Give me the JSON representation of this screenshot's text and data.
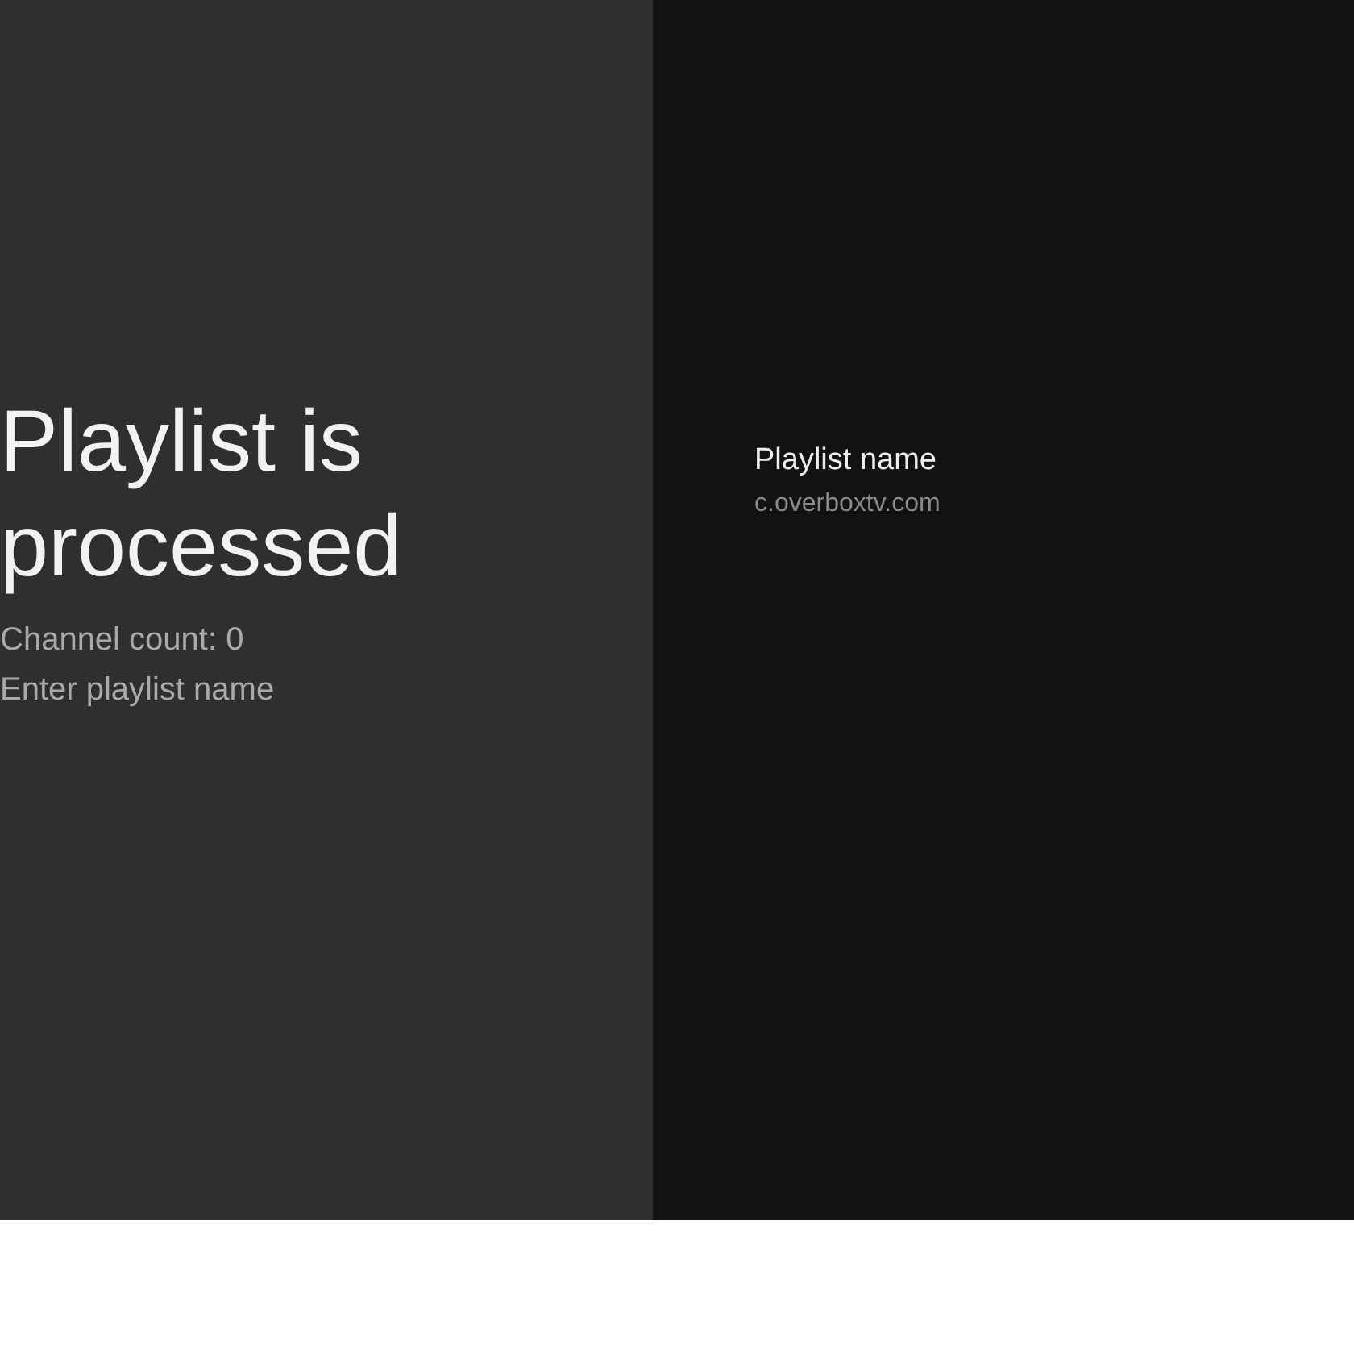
{
  "guidance": {
    "title": "Playlist is processed",
    "details": [
      "Channel count: 0",
      "Enter playlist name"
    ]
  },
  "action": {
    "title": "Playlist name",
    "description": "c.overboxtv.com"
  }
}
